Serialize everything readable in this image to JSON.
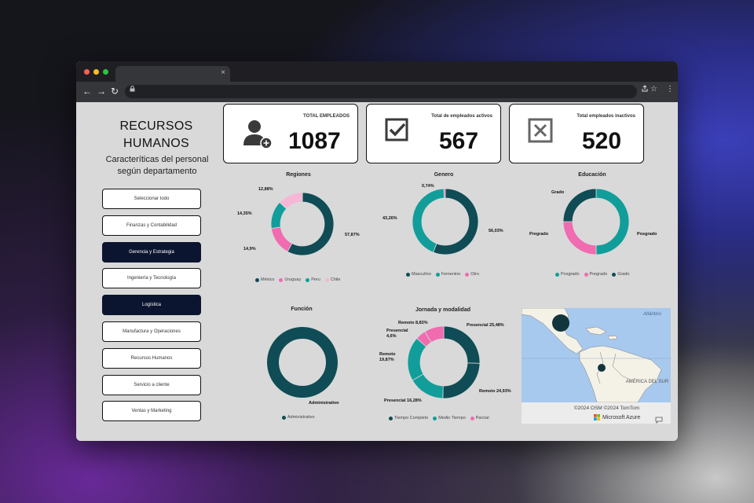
{
  "browser": {
    "tab_close": "×",
    "nav_back": "←",
    "nav_forward": "→",
    "nav_reload": "↻",
    "lock": "🔒",
    "toolbar_icons": [
      "⚠",
      "☆",
      "⋮"
    ]
  },
  "dashboard": {
    "title_line1": "RECURSOS",
    "title_line2": "HUMANOS",
    "subtitle_line1": "Caracteríticas del personal",
    "subtitle_line2": "según departamento",
    "slicers": [
      {
        "label": "Seleccionar todo",
        "selected": false
      },
      {
        "label": "Finanzas y Contabilidad",
        "selected": false
      },
      {
        "label": "Gerencia y Estrategia",
        "selected": true
      },
      {
        "label": "Ingeniería y Tecnología",
        "selected": false
      },
      {
        "label": "Logística",
        "selected": true
      },
      {
        "label": "Manufactura y Operaciones",
        "selected": false
      },
      {
        "label": "Recursos Humanos",
        "selected": false
      },
      {
        "label": "Servicio a cliente",
        "selected": false
      },
      {
        "label": "Ventas y Marketing",
        "selected": false
      }
    ],
    "kpis": [
      {
        "label": "TOTAL EMPLEADOS",
        "value": "1087",
        "icon": "add-user-icon"
      },
      {
        "label": "Total de empleados activos",
        "value": "567",
        "icon": "checkbox-checked-icon"
      },
      {
        "label": "Total empleados inactivos",
        "value": "520",
        "icon": "checkbox-x-icon"
      }
    ]
  },
  "chart_data": [
    {
      "type": "donut",
      "title": "Regiones",
      "categories": [
        "México",
        "Uruguay",
        "Peru",
        "Chile"
      ],
      "values": [
        57.87,
        14.9,
        14.35,
        12.88
      ],
      "labels": [
        "57,87%",
        "14,9%",
        "14,35%",
        "12,88%"
      ],
      "colors": [
        "#0f4c55",
        "#f06bb0",
        "#119e9a",
        "#f6b7d6"
      ]
    },
    {
      "type": "donut",
      "title": "Genero",
      "categories": [
        "Masculino",
        "Femenino",
        "Otro"
      ],
      "values": [
        56.03,
        43.26,
        0.74
      ],
      "labels": [
        "56,03%",
        "43,26%",
        "0,74%"
      ],
      "colors": [
        "#0f4c55",
        "#119e9a",
        "#f06bb0"
      ]
    },
    {
      "type": "donut",
      "title": "Educación",
      "categories": [
        "Posgrado",
        "Pregrado",
        "Grado"
      ],
      "values": [
        50,
        25,
        25
      ],
      "labels": [
        "Posgrado",
        "Pregrado",
        "Grado"
      ],
      "colors": [
        "#119e9a",
        "#f06bb0",
        "#0f4c55"
      ]
    },
    {
      "type": "donut",
      "title": "Función",
      "categories": [
        "Administrativo"
      ],
      "values": [
        100
      ],
      "labels": [
        "Administrativo"
      ],
      "colors": [
        "#0f4c55"
      ]
    },
    {
      "type": "donut",
      "title": "Jornada y modalidad",
      "legend": [
        "Tiempo Completo",
        "Medio Tiempo",
        "Parcial"
      ],
      "legend_colors": [
        "#0f4c55",
        "#119e9a",
        "#f06bb0"
      ],
      "slices": [
        {
          "label": "Presencial 25,48%",
          "value": 25.48,
          "color": "#0f4c55"
        },
        {
          "label": "Remoto 24,93%",
          "value": 24.93,
          "color": "#0f4c55"
        },
        {
          "label": "Presencial 16,28%",
          "value": 16.28,
          "color": "#119e9a"
        },
        {
          "label": "Remoto 19,87%",
          "value": 19.87,
          "color": "#119e9a"
        },
        {
          "label": "Presencial 4,6%",
          "value": 4.6,
          "color": "#f06bb0"
        },
        {
          "label": "Remoto 8,83%",
          "value": 8.83,
          "color": "#f06bb0"
        }
      ]
    }
  ],
  "map": {
    "label_ocean": "Atlántico",
    "label_region": "AMÉRICA DEL SUR",
    "copyright": "©2024 OSM ©2024 TomTom",
    "brand": "Microsoft Azure",
    "bubbles": [
      {
        "size": "large"
      },
      {
        "size": "small"
      }
    ]
  }
}
